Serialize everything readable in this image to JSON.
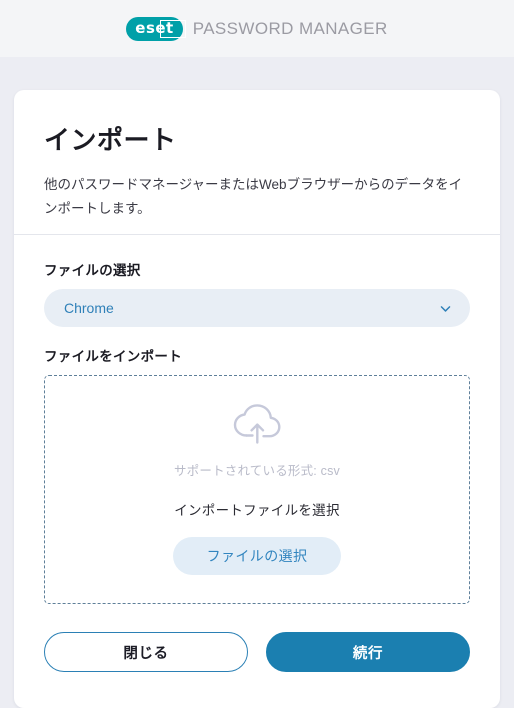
{
  "header": {
    "logo_text": "eset",
    "logo_icon": "eset-logo",
    "brand_title": "PASSWORD MANAGER",
    "logo_color": "#00a0a8",
    "brand_color": "#9b9ba3"
  },
  "card": {
    "title": "インポート",
    "description": "他のパスワードマネージャーまたはWebブラウザーからのデータをインポートします。"
  },
  "form": {
    "select_label": "ファイルの選択",
    "select_value": "Chrome",
    "select_options": [
      "Chrome"
    ],
    "chevron_icon": "chevron-down-icon",
    "import_label": "ファイルをインポート"
  },
  "dropzone": {
    "cloud_icon": "cloud-upload-icon",
    "supported_formats": "サポートされている形式: csv",
    "prompt": "インポートファイルを選択",
    "choose_file_label": "ファイルの選択"
  },
  "footer": {
    "close_label": "閉じる",
    "continue_label": "続行"
  },
  "colors": {
    "primary": "#1b7fb0",
    "accent_teal": "#00a0a8",
    "page_background": "#ecedf3",
    "header_background": "#f4f5f7",
    "select_background": "#e8eef5",
    "dropzone_border": "#5e7f99"
  }
}
